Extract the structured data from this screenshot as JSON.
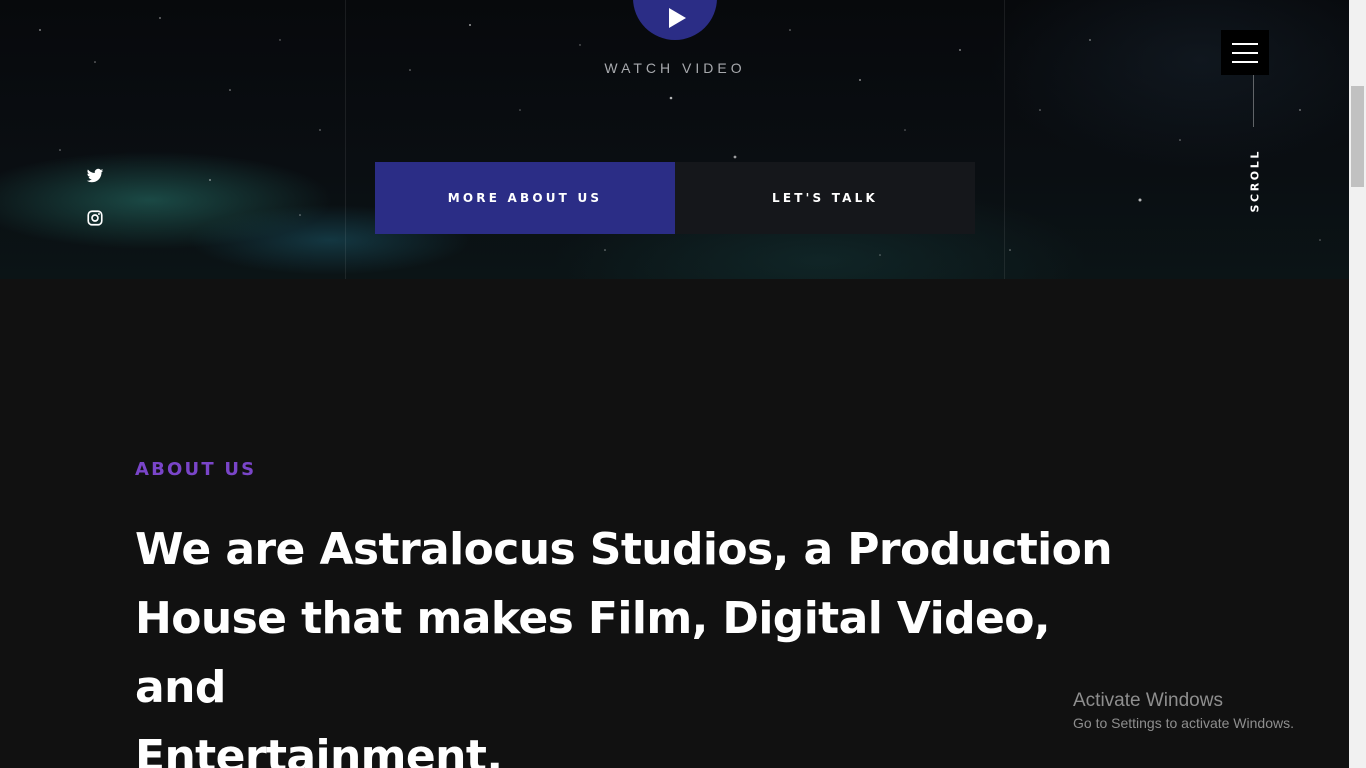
{
  "hero": {
    "watch_label": "WATCH VIDEO",
    "buttons": {
      "primary_label": "MORE ABOUT US",
      "secondary_label": "LET'S TALK"
    },
    "scroll_label": "SCROLL",
    "social": [
      "twitter-icon",
      "instagram-icon"
    ],
    "icons": {
      "play": "play-icon",
      "menu": "hamburger-menu-icon"
    }
  },
  "about": {
    "eyebrow": "ABOUT US",
    "heading_lines": [
      "We are Astralocus Studios, a Production",
      "House that makes Film, Digital Video, and",
      "Entertainment."
    ]
  },
  "watermark": {
    "title": "Activate Windows",
    "subtitle": "Go to Settings to activate Windows."
  },
  "colors": {
    "accent": "#2b2d86",
    "eyebrow": "#7a45c9",
    "background": "#111111",
    "secondary_button": "#15171b"
  }
}
